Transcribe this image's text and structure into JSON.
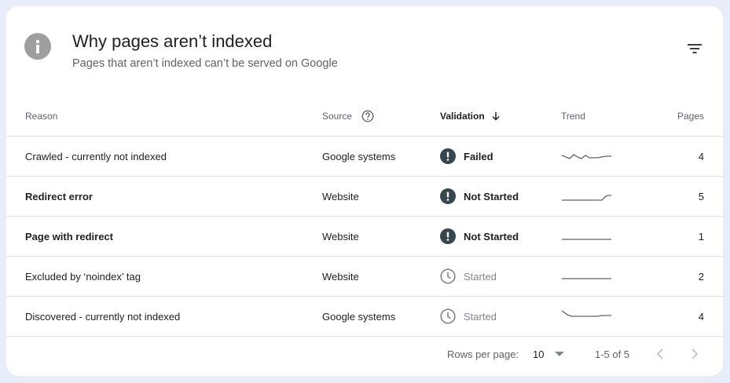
{
  "header": {
    "title": "Why pages aren’t indexed",
    "subtitle": "Pages that aren’t indexed can’t be served on Google",
    "info_icon": "info-icon",
    "filter_icon": "filter-icon"
  },
  "table": {
    "columns": {
      "reason": "Reason",
      "source": "Source",
      "validation": "Validation",
      "trend": "Trend",
      "pages": "Pages"
    },
    "rows": [
      {
        "reason": "Crawled - currently not indexed",
        "source": "Google systems",
        "validation": "Failed",
        "pages": "4"
      },
      {
        "reason": "Redirect error",
        "source": "Website",
        "validation": "Not Started",
        "pages": "5"
      },
      {
        "reason": "Page with redirect",
        "source": "Website",
        "validation": "Not Started",
        "pages": "1"
      },
      {
        "reason": "Excluded by ‘noindex’ tag",
        "source": "Website",
        "validation": "Started",
        "pages": "2"
      },
      {
        "reason": "Discovered - currently not indexed",
        "source": "Google systems",
        "validation": "Started",
        "pages": "4"
      }
    ]
  },
  "footer": {
    "rows_per_page_label": "Rows per page:",
    "rows_per_page_value": "10",
    "range": "1-5 of 5"
  },
  "colors": {
    "background": "#e8eef9",
    "status_dark": "#37474f",
    "status_started": "#80868b"
  }
}
